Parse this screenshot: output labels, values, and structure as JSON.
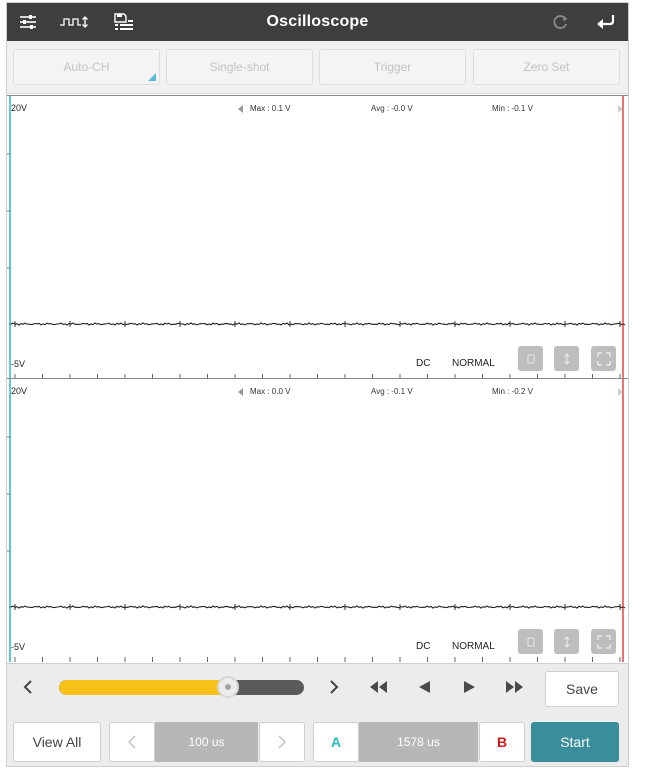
{
  "header": {
    "title": "Oscilloscope"
  },
  "modes": {
    "auto_ch": "Auto-CH",
    "single_shot": "Single-shot",
    "trigger": "Trigger",
    "zero_set": "Zero Set"
  },
  "channels": [
    {
      "top_scale": "20V",
      "bottom_scale": "-5V",
      "max": "Max : 0.1 V",
      "avg": "Avg : -0.0 V",
      "min": "Min : -0.1 V",
      "coupling": "DC",
      "mode": "NORMAL"
    },
    {
      "top_scale": "20V",
      "bottom_scale": "-5V",
      "max": "Max : 0.0 V",
      "avg": "Avg : -0.1 V",
      "min": "Min : -0.2 V",
      "coupling": "DC",
      "mode": "NORMAL"
    }
  ],
  "controls": {
    "slider_fraction": 0.69,
    "save_label": "Save",
    "view_all_label": "View All",
    "timebase": "100 us",
    "cursor_a": "A",
    "cursor_delta": "1578 us",
    "cursor_b": "B",
    "start_label": "Start"
  },
  "colors": {
    "accent": "#3a8e9c",
    "cursor_a": "#2ab7c8",
    "cursor_b": "#d11a1a",
    "slider": "#f6c21a"
  }
}
